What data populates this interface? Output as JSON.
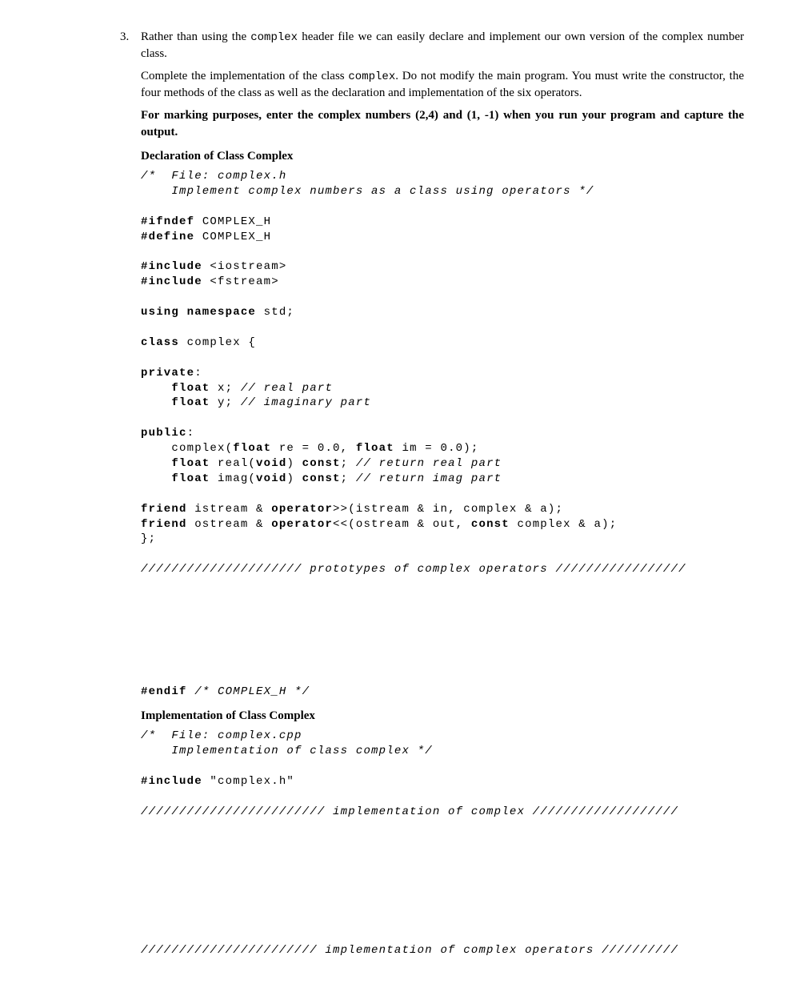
{
  "q": {
    "num": "3.",
    "p1a": "Rather than using the ",
    "p1code": "complex",
    "p1b": " header file we can easily declare and implement our own version of the complex number class.",
    "p2a": "Complete the implementation of the class ",
    "p2code": "complex",
    "p2b": ". Do not modify the main program. You must write the constructor, the four methods of the class as well as the declaration and implementation of the six operators.",
    "p3": "For marking purposes, enter the complex numbers (2,4) and (1, -1) when you run your program and capture the output.",
    "head1": "Declaration of Class Complex",
    "head2": "Implementation of Class Complex"
  },
  "code1": {
    "c1": "/*  File: complex.h",
    "c2": "    Implement complex numbers as a class using operators */",
    "c3": "#ifndef COMPLEX_H",
    "c4": "#define COMPLEX_H",
    "c5": "#include <iostream>",
    "c6": "#include <fstream>",
    "c7": "using namespace std;",
    "c8": "class complex {",
    "c9": "private:",
    "c10": "    float x; // real part",
    "c11": "    float y; // imaginary part",
    "c12": "public:",
    "c13": "    complex(float re = 0.0, float im = 0.0);",
    "c14": "    float real(void) const; // return real part",
    "c15": "    float imag(void) const; // return imag part",
    "c16": "friend istream & operator>>(istream & in, complex & a);",
    "c17": "friend ostream & operator<<(ostream & out, const complex & a);",
    "c18": "};",
    "c19": "///////////////////// prototypes of complex operators /////////////////",
    "c20": "#endif /* COMPLEX_H */"
  },
  "code2": {
    "c1": "/*  File: complex.cpp",
    "c2": "    Implementation of class complex */",
    "c3": "#include \"complex.h\"",
    "c4": "//////////////////////// implementation of complex ///////////////////",
    "c5": "/////////////////////// implementation of complex operators //////////"
  }
}
